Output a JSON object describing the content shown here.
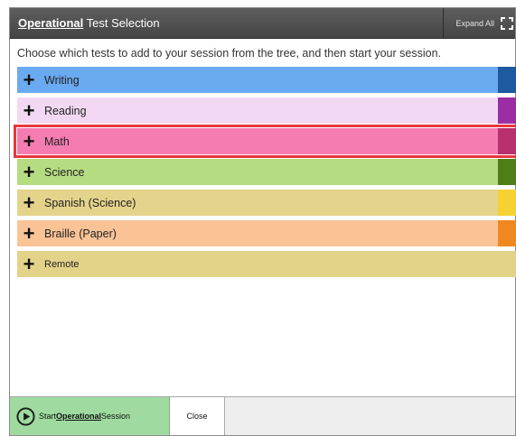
{
  "dialog": {
    "title_strong": "Operational",
    "title_rest": " Test Selection",
    "expand_all_label": "Expand All",
    "instruction": "Choose which tests to add to your session from the tree, and then start your session."
  },
  "tree": {
    "items": [
      {
        "label": "Writing",
        "row_color": "#6aaaf0",
        "swatch_color": "#1d5aa0",
        "selected": false
      },
      {
        "label": "Reading",
        "row_color": "#f3d8f3",
        "swatch_color": "#9b2ea4",
        "selected": false
      },
      {
        "label": "Math",
        "row_color": "#f57cb1",
        "swatch_color": "#b8306e",
        "selected": true
      },
      {
        "label": "Science",
        "row_color": "#b6dc82",
        "swatch_color": "#4f7e19",
        "selected": false
      },
      {
        "label": "Spanish (Science)",
        "row_color": "#e4d38a",
        "swatch_color": "#f5d232",
        "selected": false
      },
      {
        "label": "Braille (Paper)",
        "row_color": "#f9c396",
        "swatch_color": "#f08822",
        "selected": false
      },
      {
        "label": "Remote",
        "row_color": "#e3d389",
        "swatch_color": "#e3d389",
        "selected": false
      }
    ]
  },
  "footer": {
    "start_prefix": "Start ",
    "start_strong": "Operational",
    "start_suffix": " Session",
    "close_label": "Close"
  }
}
